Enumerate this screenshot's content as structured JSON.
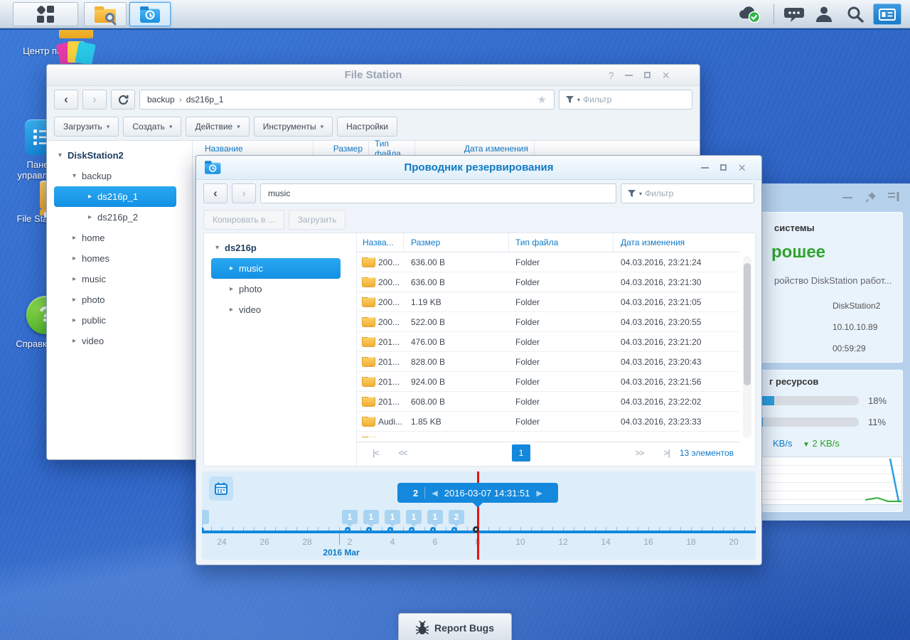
{
  "taskbar": {
    "left_icons": [
      "main-menu-icon",
      "file-station-icon",
      "hyper-backup-icon"
    ],
    "tray_icons": [
      "cloud-sync-icon",
      "chat-icon",
      "user-icon",
      "search-icon",
      "widgets-icon"
    ]
  },
  "desktop": {
    "icons": [
      {
        "label": "Центр пакетов"
      },
      {
        "label": "Панель управления"
      },
      {
        "label": "File Station"
      },
      {
        "label": "Справка DSM"
      }
    ],
    "report_bugs_label": "Report Bugs"
  },
  "file_station": {
    "title": "File Station",
    "controls": {
      "help": "?",
      "close": "×"
    },
    "nav": {
      "breadcrumb": [
        "backup",
        "ds216p_1"
      ],
      "crumb_sep": "›",
      "star_icon": "★",
      "filter_placeholder": "Фильтр"
    },
    "toolbar": [
      {
        "label": "Загрузить",
        "dropdown": true
      },
      {
        "label": "Создать",
        "dropdown": true
      },
      {
        "label": "Действие",
        "dropdown": true
      },
      {
        "label": "Инструменты",
        "dropdown": true
      },
      {
        "label": "Настройки",
        "dropdown": false
      }
    ],
    "nav_icons": {
      "back": "‹",
      "forward": "›"
    },
    "tree": [
      {
        "label": "DiskStation2",
        "level": 0,
        "expanded": true,
        "bold": true
      },
      {
        "label": "backup",
        "level": 1,
        "expanded": true
      },
      {
        "label": "ds216p_1",
        "level": 2,
        "selected": true
      },
      {
        "label": "ds216p_2",
        "level": 2
      },
      {
        "label": "home",
        "level": 1
      },
      {
        "label": "homes",
        "level": 1
      },
      {
        "label": "music",
        "level": 1
      },
      {
        "label": "photo",
        "level": 1
      },
      {
        "label": "public",
        "level": 1
      },
      {
        "label": "video",
        "level": 1
      }
    ],
    "columns": [
      "Название",
      "Размер",
      "Тип файла",
      "Дата изменения"
    ]
  },
  "backup_explorer": {
    "title": "Проводник резервирования",
    "path": "music",
    "filter_placeholder": "Фильтр",
    "nav_icons": {
      "back": "‹",
      "forward": "›"
    },
    "actions": [
      "Копировать в ...",
      "Загрузить"
    ],
    "tree": [
      {
        "label": "ds216p",
        "level": 0,
        "expanded": true,
        "bold": true
      },
      {
        "label": "music",
        "level": 1,
        "selected": true
      },
      {
        "label": "photo",
        "level": 1
      },
      {
        "label": "video",
        "level": 1
      }
    ],
    "table": {
      "columns": [
        "Назва...",
        "Размер",
        "Тип файла",
        "Дата изменения"
      ],
      "rows": [
        {
          "name": "200...",
          "size": "636.00 B",
          "type": "Folder",
          "modified": "04.03.2016, 23:21:24"
        },
        {
          "name": "200...",
          "size": "636.00 B",
          "type": "Folder",
          "modified": "04.03.2016, 23:21:30"
        },
        {
          "name": "200...",
          "size": "1.19 KB",
          "type": "Folder",
          "modified": "04.03.2016, 23:21:05"
        },
        {
          "name": "200...",
          "size": "522.00 B",
          "type": "Folder",
          "modified": "04.03.2016, 23:20:55"
        },
        {
          "name": "201...",
          "size": "476.00 B",
          "type": "Folder",
          "modified": "04.03.2016, 23:21:20"
        },
        {
          "name": "201...",
          "size": "828.00 B",
          "type": "Folder",
          "modified": "04.03.2016, 23:20:43"
        },
        {
          "name": "201...",
          "size": "924.00 B",
          "type": "Folder",
          "modified": "04.03.2016, 23:21:56"
        },
        {
          "name": "201...",
          "size": "608.00 B",
          "type": "Folder",
          "modified": "04.03.2016, 23:22:02"
        },
        {
          "name": "Audi...",
          "size": "1.85 KB",
          "type": "Folder",
          "modified": "04.03.2016, 23:23:33"
        }
      ]
    },
    "pagination": {
      "first": "|<",
      "prev": "<<",
      "page": "1",
      "next": ">>",
      "last": ">|",
      "count": "13 элементов"
    },
    "timeline": {
      "tooltip": {
        "count": "2",
        "prev_icon": "◀",
        "datetime": "2016-03-07 14:31:51",
        "next_icon": "▶"
      },
      "month_label": "2016 Mar",
      "axis_labels": [
        "24",
        "26",
        "28",
        "2",
        "4",
        "6",
        "8",
        "10",
        "12",
        "14",
        "16",
        "18",
        "20"
      ],
      "markers": [
        {
          "count": "1"
        },
        {
          "count": "1"
        },
        {
          "count": "1"
        },
        {
          "count": "1"
        },
        {
          "count": "1"
        },
        {
          "count": "2"
        }
      ]
    }
  },
  "widget_panel": {
    "system_health": {
      "title_visible": "системы",
      "status_visible": "рошее",
      "description_visible": "ройство DiskStation работ...",
      "server_name": "DiskStation2",
      "ip": "10.10.10.89",
      "uptime": "00:59:29"
    },
    "resource_monitor": {
      "title_visible": "г ресурсов",
      "cpu_percent": "18%",
      "ram_percent": "11%",
      "net_up_visible": "KB/s",
      "net_down_arrow": "▼",
      "net_down": "2 KB/s"
    }
  }
}
